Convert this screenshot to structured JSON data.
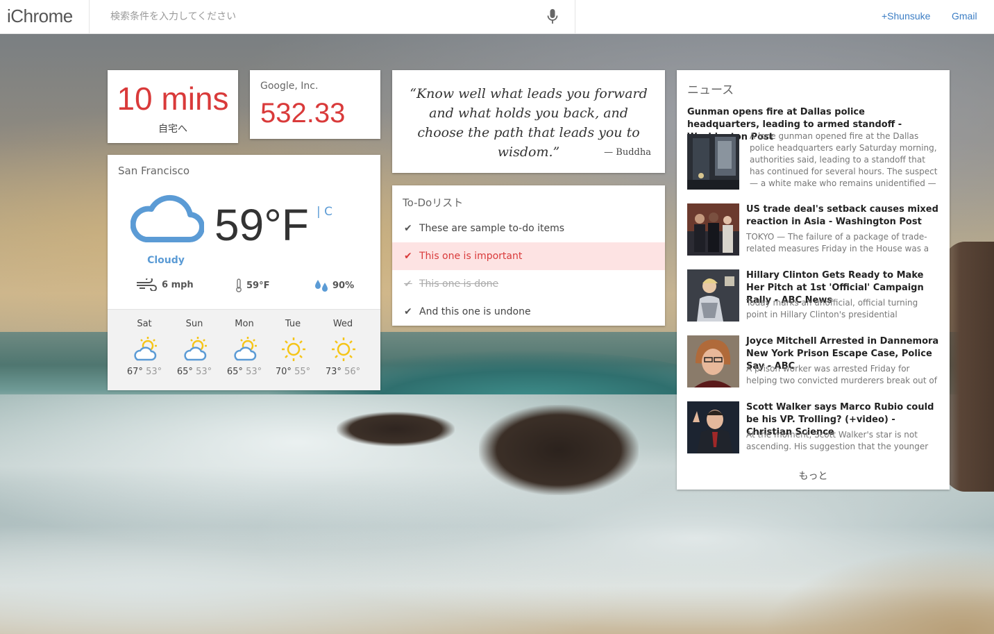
{
  "header": {
    "logo": "iChrome",
    "search_placeholder": "検索条件を入力してください",
    "user_link": "+Shunsuke",
    "gmail_link": "Gmail"
  },
  "commute": {
    "time": "10 mins",
    "destination": "自宅へ"
  },
  "stock": {
    "company": "Google, Inc.",
    "price": "532.33"
  },
  "weather": {
    "city": "San Francisco",
    "temperature": "59°F",
    "unit_toggle": "| C",
    "condition": "Cloudy",
    "wind": "6 mph",
    "feels_like": "59°F",
    "humidity": "90%",
    "forecast": [
      {
        "day": "Sat",
        "high": "67°",
        "low": "53°",
        "icon": "partly-cloudy-icon"
      },
      {
        "day": "Sun",
        "high": "65°",
        "low": "53°",
        "icon": "partly-cloudy-icon"
      },
      {
        "day": "Mon",
        "high": "65°",
        "low": "53°",
        "icon": "partly-cloudy-icon"
      },
      {
        "day": "Tue",
        "high": "70°",
        "low": "55°",
        "icon": "sun-icon"
      },
      {
        "day": "Wed",
        "high": "73°",
        "low": "56°",
        "icon": "sun-icon"
      }
    ],
    "colors": {
      "condition": "#5b9bd5",
      "sun": "#f5c518",
      "cloud": "#5b9bd5"
    }
  },
  "quote": {
    "text": "“Know well what leads you forward and what holds you back, and choose the path that leads you to wisdom.”",
    "author": "— Buddha"
  },
  "todo": {
    "title": "To-Doリスト",
    "items": [
      {
        "text": "These are sample to-do items",
        "state": "normal"
      },
      {
        "text": "This one is important",
        "state": "important"
      },
      {
        "text": "This one is done",
        "state": "done"
      },
      {
        "text": "And this one is undone",
        "state": "normal"
      }
    ]
  },
  "news": {
    "title": "ニュース",
    "items": [
      {
        "headline": "Gunman opens fire at Dallas police headquarters, leading to armed standoff - Washington Post",
        "summary": "A lone gunman opened fire at the Dallas police headquarters early Saturday morning, authorities said, leading to a standoff that has continued for several hours. The suspect — a white make who remains unidentified — was"
      },
      {
        "headline": "US trade deal's setback causes mixed reaction in Asia - Washington Post",
        "summary": "TOKYO — The failure of a package of trade-related measures Friday in the House was a blow"
      },
      {
        "headline": "Hillary Clinton Gets Ready to Make Her Pitch at 1st 'Official' Campaign Rally - ABC News",
        "summary": "Today marks an unofficial, official turning point in Hillary Clinton's presidential campaign. Later"
      },
      {
        "headline": "Joyce Mitchell Arrested in Dannemora New York Prison Escape Case, Police Say - ABC",
        "summary": "A prison worker was arrested Friday for helping two convicted murderers break out of an upstate"
      },
      {
        "headline": "Scott Walker says Marco Rubio could be his VP. Trolling? (+video) - Christian Science",
        "summary": "At the moment, Scott Walker's star is not ascending. His suggestion that the younger"
      }
    ],
    "more": "もっと"
  },
  "accent_colors": {
    "link": "#3b7dc4",
    "alert": "#d93a3a",
    "important_bg": "#fde3e3"
  }
}
